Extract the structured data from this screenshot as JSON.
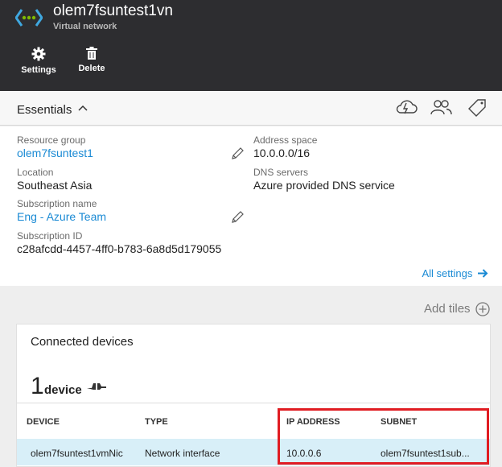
{
  "header": {
    "title": "olem7fsuntest1vn",
    "subtitle": "Virtual network",
    "commands": [
      {
        "label": "Settings",
        "icon": "gear-icon"
      },
      {
        "label": "Delete",
        "icon": "trash-icon"
      }
    ]
  },
  "essentials": {
    "title": "Essentials",
    "tools": [
      "cloud-icon",
      "users-icon",
      "tag-icon"
    ],
    "resource_group": {
      "label": "Resource group",
      "value": "olem7fsuntest1"
    },
    "location": {
      "label": "Location",
      "value": "Southeast Asia"
    },
    "subscription_name": {
      "label": "Subscription name",
      "value": "Eng - Azure Team"
    },
    "subscription_id": {
      "label": "Subscription ID",
      "value": "c28afcdd-4457-4ff0-b783-6a8d5d179055"
    },
    "address_space": {
      "label": "Address space",
      "value": "10.0.0.0/16"
    },
    "dns_servers": {
      "label": "DNS servers",
      "value": "Azure provided DNS service"
    },
    "all_settings": "All settings"
  },
  "add_tiles": "Add tiles",
  "tile": {
    "title": "Connected devices",
    "count": "1",
    "count_word": "device",
    "columns": [
      "DEVICE",
      "TYPE",
      "IP ADDRESS",
      "SUBNET"
    ],
    "rows": [
      {
        "device": "olem7fsuntest1vmNic",
        "type": "Network interface",
        "ip": "10.0.0.6",
        "subnet": "olem7fsuntest1sub..."
      }
    ]
  },
  "colors": {
    "accent": "#1a8ad4",
    "header_bg": "#2d2d30",
    "highlight": "#e01c22",
    "row_selected": "#d8eff8"
  }
}
